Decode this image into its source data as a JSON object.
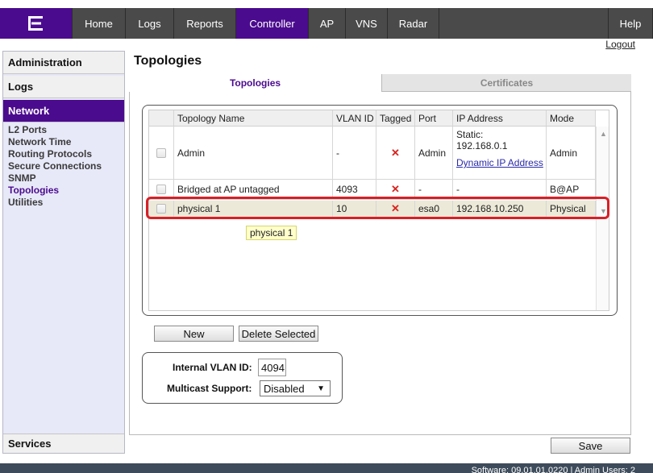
{
  "nav": {
    "items": [
      {
        "label": "Home",
        "width": 66,
        "active": false
      },
      {
        "label": "Logs",
        "width": 60,
        "active": false
      },
      {
        "label": "Reports",
        "width": 77,
        "active": false
      },
      {
        "label": "Controller",
        "width": 90,
        "active": true
      },
      {
        "label": "AP",
        "width": 46,
        "active": false
      },
      {
        "label": "VNS",
        "width": 52,
        "active": false
      },
      {
        "label": "Radar",
        "width": 64,
        "active": false
      }
    ],
    "help": "Help",
    "logout": "Logout"
  },
  "sidebar": {
    "administration": "Administration",
    "logs": "Logs",
    "network": "Network",
    "links": [
      "L2 Ports",
      "Network Time",
      "Routing Protocols",
      "Secure Connections",
      "SNMP",
      "Topologies",
      "Utilities"
    ],
    "active_link": "Topologies",
    "services": "Services"
  },
  "page": {
    "title": "Topologies",
    "tab_topologies": "Topologies",
    "tab_certificates": "Certificates"
  },
  "table": {
    "headers": [
      "Topology Name",
      "VLAN ID",
      "Tagged",
      "Port",
      "IP Address",
      "Mode"
    ],
    "rows": [
      {
        "name": "Admin",
        "vlan": "-",
        "port": "Admin",
        "ip_static": "Static:",
        "ip_addr": "192.168.0.1",
        "ip_link": "Dynamic IP Address",
        "mode": "Admin"
      },
      {
        "name": "Bridged at AP untagged",
        "vlan": "4093",
        "port": "-",
        "ip": "-",
        "mode": "B@AP"
      },
      {
        "name": "physical 1",
        "vlan": "10",
        "port": "esa0",
        "ip": "192.168.10.250",
        "mode": "Physical"
      }
    ],
    "tooltip": "physical 1"
  },
  "buttons": {
    "new": "New",
    "delete": "Delete Selected",
    "save": "Save"
  },
  "settings": {
    "vlan_label": "Internal VLAN ID:",
    "vlan_value": "4094",
    "multicast_label": "Multicast Support:",
    "multicast_value": "Disabled"
  },
  "footer": "Software: 09.01.01.0220 | Admin Users: 2",
  "colors": {
    "brand": "#4b0b8e",
    "highlight": "#d81f26"
  }
}
